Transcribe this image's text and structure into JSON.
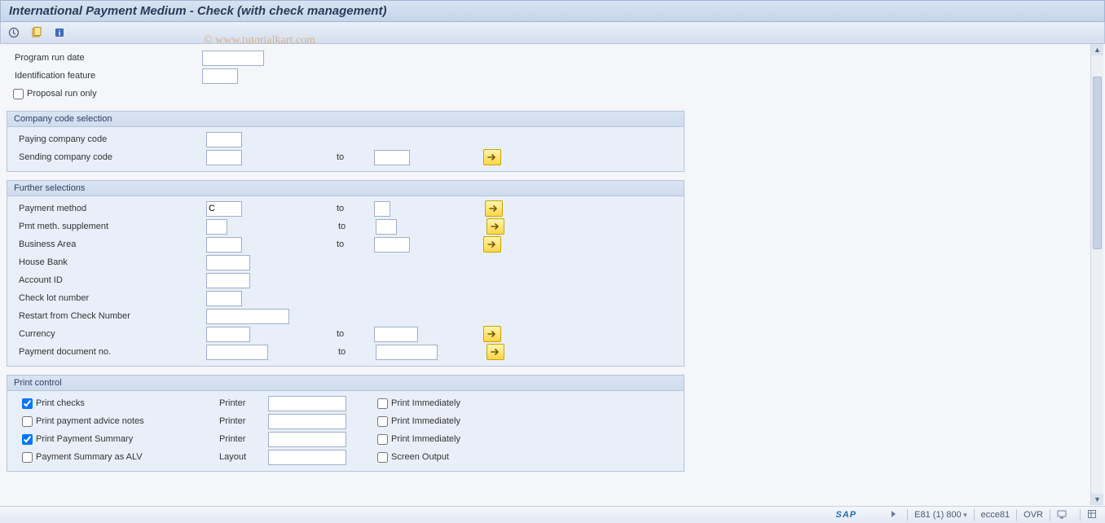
{
  "title": "International Payment Medium - Check (with check management)",
  "watermark": "© www.tutorialkart.com",
  "top": {
    "program_run_date": "Program run date",
    "ident_feature": "Identification feature",
    "proposal_run_only": "Proposal run only"
  },
  "group1": {
    "title": "Company code selection",
    "paying_cc": "Paying company code",
    "sending_cc": "Sending company code",
    "to": "to"
  },
  "group2": {
    "title": "Further selections",
    "payment_method": "Payment method",
    "payment_method_val": "C",
    "pmt_supp": "Pmt meth. supplement",
    "bus_area": "Business Area",
    "house_bank": "House Bank",
    "account_id": "Account ID",
    "check_lot": "Check lot number",
    "restart_chk": "Restart from Check Number",
    "currency": "Currency",
    "pay_doc_no": "Payment document no.",
    "to": "to"
  },
  "group3": {
    "title": "Print control",
    "rows": [
      {
        "chk": true,
        "label": "Print checks",
        "col2": "Printer",
        "chk2": false,
        "label2": "Print Immediately"
      },
      {
        "chk": false,
        "label": "Print payment advice notes",
        "col2": "Printer",
        "chk2": false,
        "label2": "Print Immediately"
      },
      {
        "chk": true,
        "label": "Print Payment Summary",
        "col2": "Printer",
        "chk2": false,
        "label2": "Print Immediately"
      },
      {
        "chk": false,
        "label": "Payment Summary as ALV",
        "col2": "Layout",
        "chk2": false,
        "label2": "Screen Output"
      }
    ]
  },
  "status": {
    "sap": "SAP",
    "session": "E81 (1) 800",
    "server": "ecce81",
    "mode": "OVR"
  }
}
